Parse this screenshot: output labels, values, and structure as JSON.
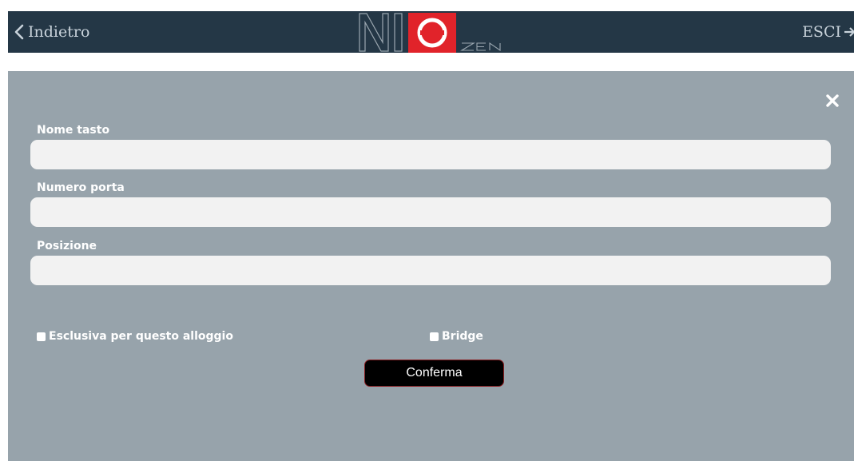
{
  "header": {
    "back_label": "Indietro",
    "exit_label": "ESCI",
    "logo": {
      "letters": "NI",
      "suffix": "ZEN",
      "accent_color": "#e1232a"
    },
    "background_color": "#243746"
  },
  "form": {
    "fields": [
      {
        "label": "Nome tasto",
        "value": "",
        "placeholder": ""
      },
      {
        "label": "Numero porta",
        "value": "",
        "placeholder": ""
      },
      {
        "label": "Posizione",
        "value": "",
        "placeholder": ""
      }
    ],
    "checkboxes": [
      {
        "label": "Esclusiva per questo alloggio",
        "checked": false
      },
      {
        "label": "Bridge",
        "checked": false
      }
    ],
    "confirm_label": "Conferma",
    "background_color": "#97a3ab"
  },
  "icons": {
    "back": "chevron-left-icon",
    "exit": "exit-icon",
    "close": "close-icon"
  }
}
